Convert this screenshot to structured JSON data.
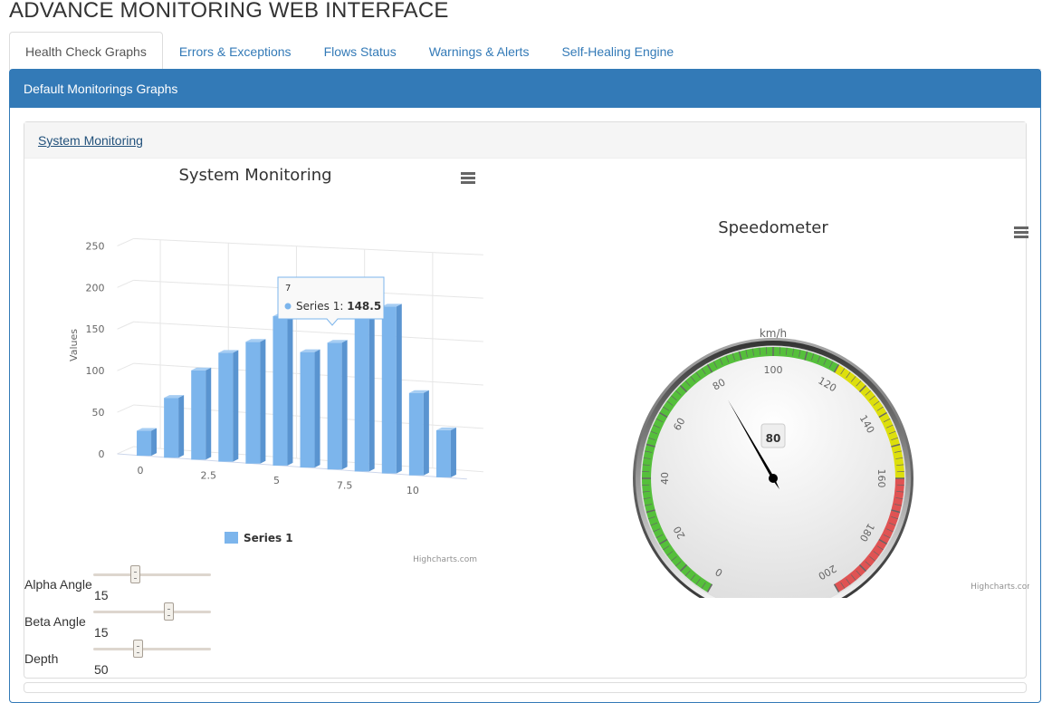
{
  "app": {
    "title": "ADVANCE MONITORING WEB INTERFACE"
  },
  "tabs": [
    {
      "label": "Health Check Graphs",
      "active": true
    },
    {
      "label": "Errors & Exceptions"
    },
    {
      "label": "Flows Status"
    },
    {
      "label": "Warnings & Alerts"
    },
    {
      "label": "Self-Healing Engine"
    }
  ],
  "panel": {
    "heading": "Default Monitorings Graphs"
  },
  "section": {
    "link": "System Monitoring"
  },
  "chart_data": [
    {
      "type": "bar",
      "title": "System Monitoring",
      "ylabel": "Values",
      "ylim": [
        0,
        250
      ],
      "yticks": [
        "0",
        "50",
        "100",
        "150",
        "200",
        "250"
      ],
      "xticks": [
        "0",
        "2.5",
        "5",
        "7.5",
        "10"
      ],
      "x": [
        0,
        1,
        2,
        3,
        4,
        5,
        6,
        7,
        8,
        9,
        10,
        11
      ],
      "series": [
        {
          "name": "Series 1",
          "values": [
            29.9,
            71.5,
            106.4,
            129.2,
            144.0,
            176.0,
            135.6,
            148.5,
            216.4,
            194.1,
            95.6,
            54.4
          ],
          "color": "#7cb5ec"
        }
      ],
      "tooltip": {
        "x": "7",
        "series": "Series 1: ",
        "value": "148.5"
      },
      "credit": "Highcharts.com"
    },
    {
      "type": "gauge",
      "title": "Speedometer",
      "unit": "km/h",
      "min": 0,
      "max": 200,
      "value": 80,
      "value_label": "80",
      "ticks": [
        "0",
        "20",
        "40",
        "60",
        "80",
        "100",
        "120",
        "140",
        "160",
        "180",
        "200"
      ],
      "bands": [
        {
          "from": 0,
          "to": 120,
          "color": "#55BF3B"
        },
        {
          "from": 120,
          "to": 160,
          "color": "#DDDF0D"
        },
        {
          "from": 160,
          "to": 200,
          "color": "#DF5353"
        }
      ],
      "credit": "Highcharts.com"
    }
  ],
  "controls": [
    {
      "label": "Alpha Angle",
      "value": "15",
      "level": 0.35
    },
    {
      "label": "Beta Angle",
      "value": "15",
      "level": 0.64
    },
    {
      "label": "Depth",
      "value": "50",
      "level": 0.38
    }
  ]
}
